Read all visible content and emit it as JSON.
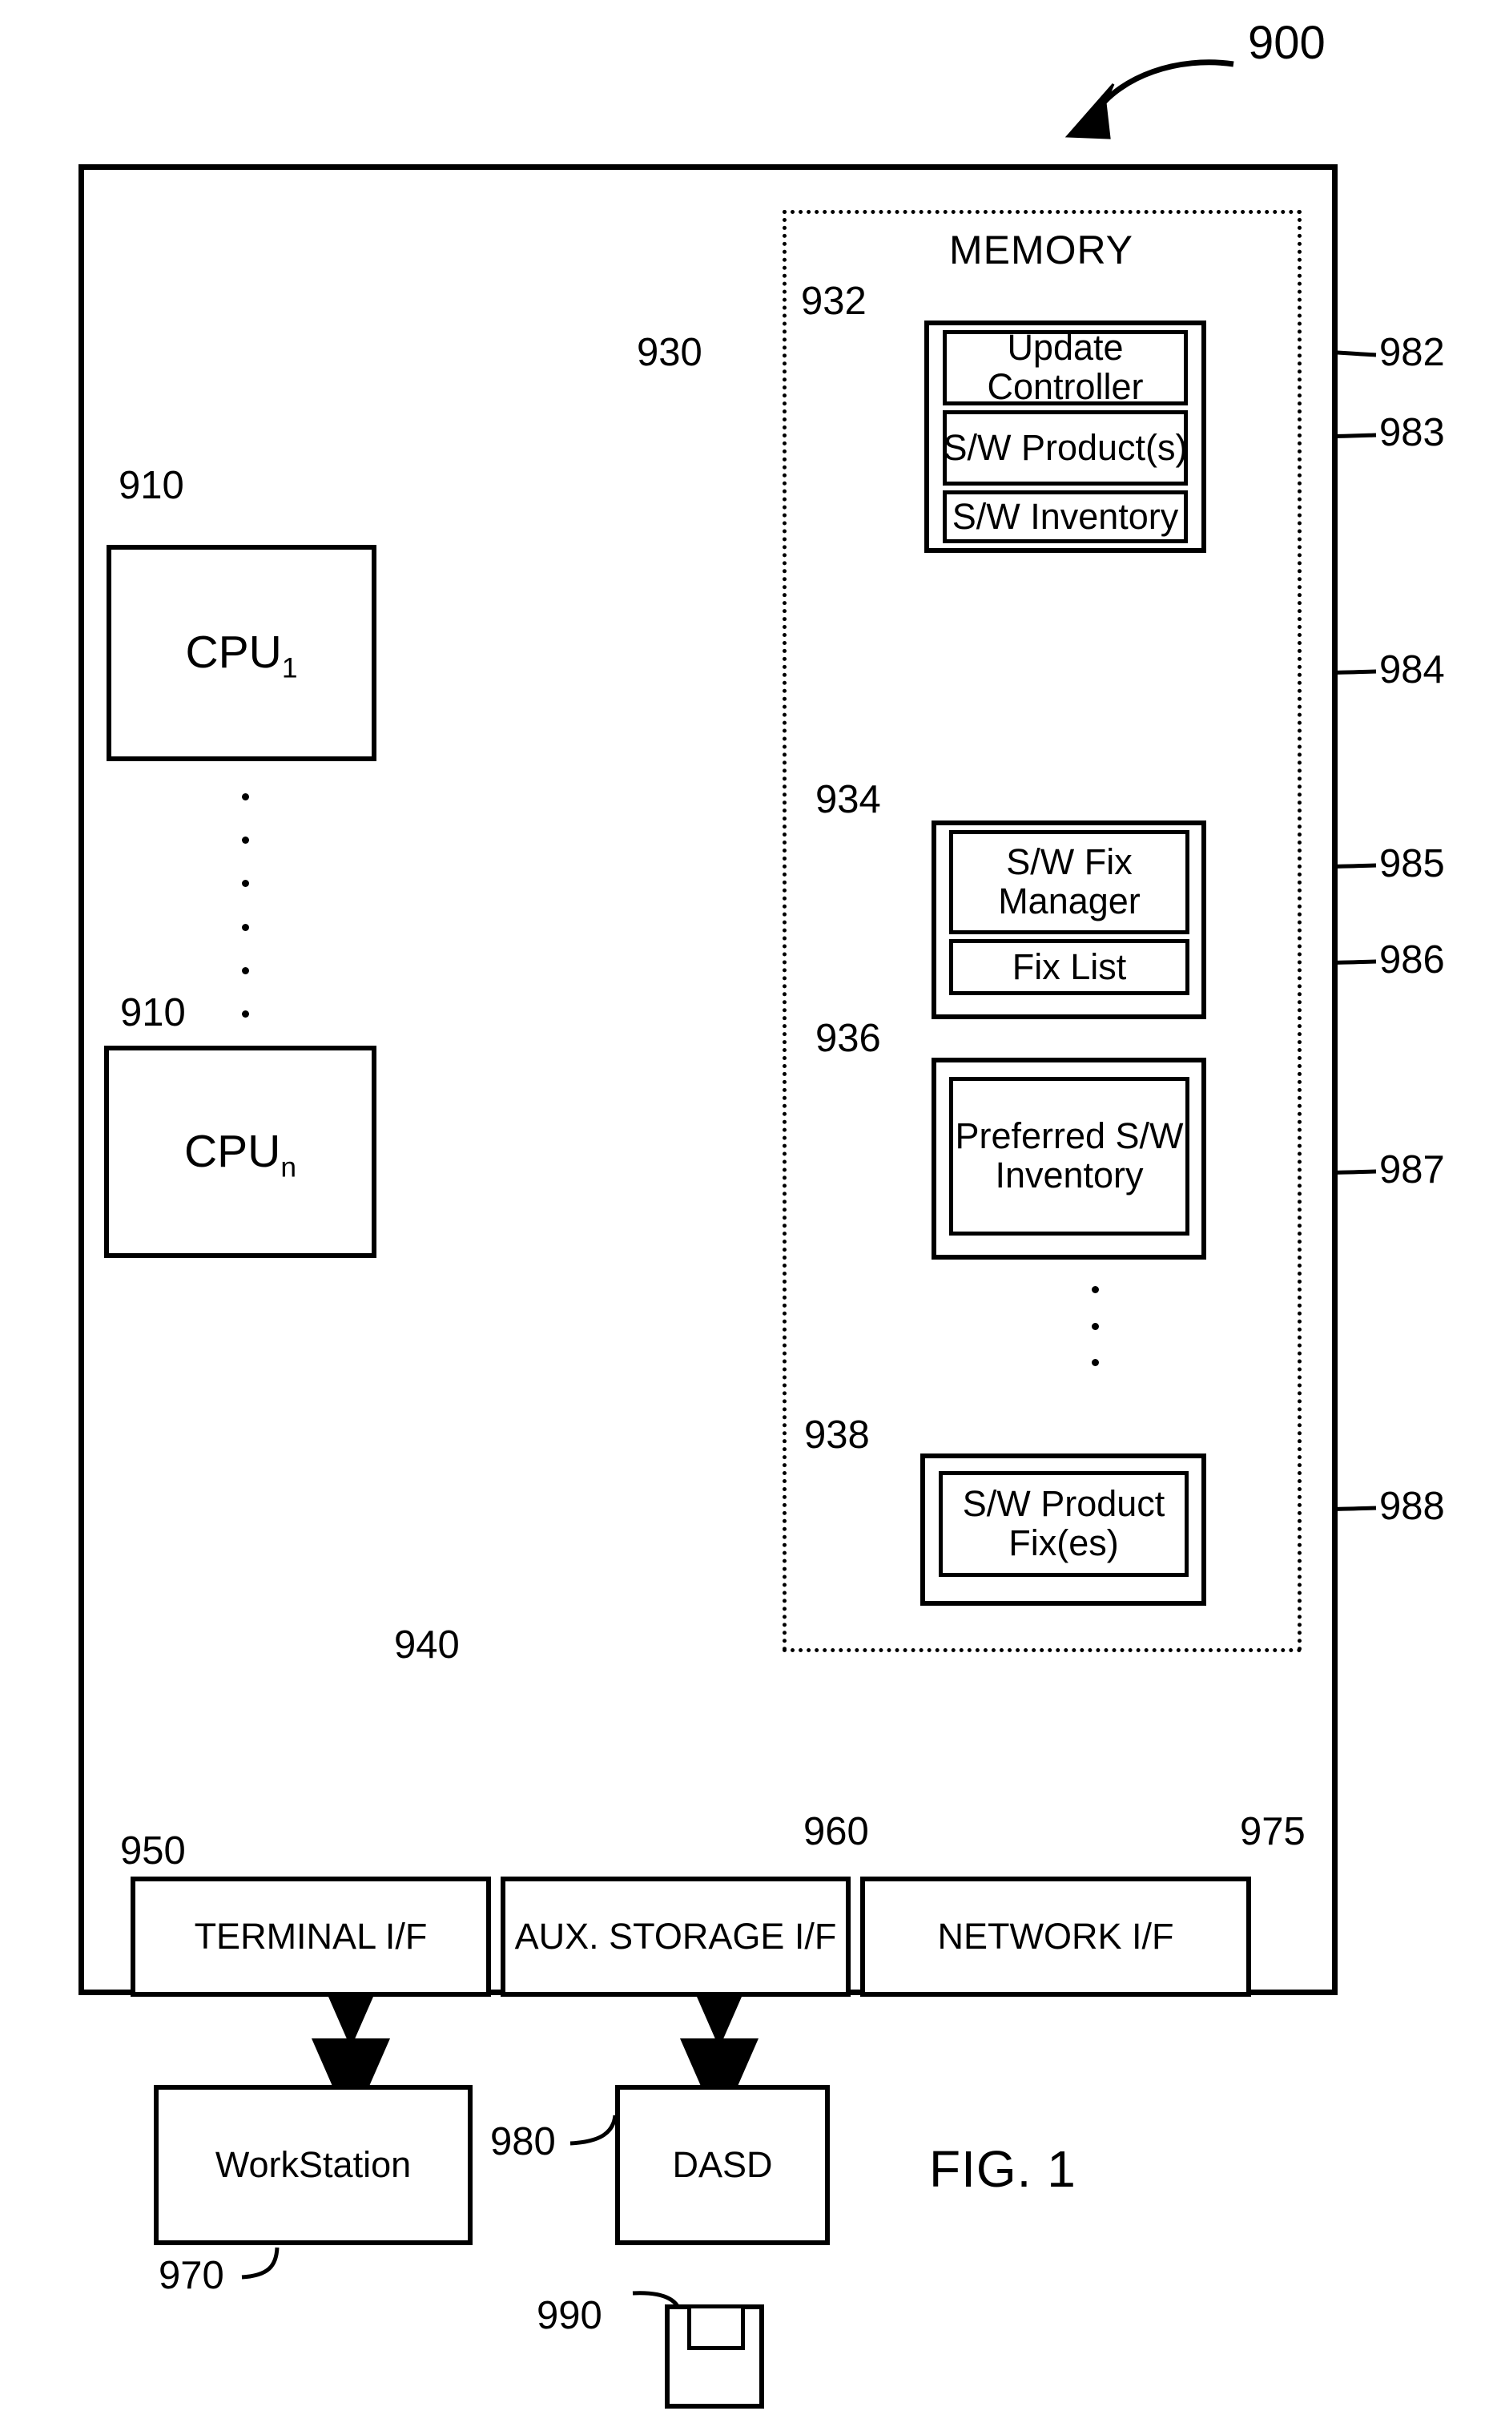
{
  "figure": {
    "label": "FIG. 1",
    "system_ref": "900"
  },
  "system": {
    "memory": {
      "title": "MEMORY",
      "ref": "930",
      "modules": [
        {
          "ref": "932",
          "cells": [
            {
              "text": "Update Controller",
              "ref": "982"
            },
            {
              "text": "S/W Product(s)",
              "ref": "983"
            },
            {
              "text": "S/W Inventory",
              "ref": "984"
            }
          ]
        },
        {
          "ref": "934",
          "cells": [
            {
              "text": "S/W Fix Manager",
              "ref": "985"
            },
            {
              "text": "Fix List",
              "ref": "986"
            }
          ]
        },
        {
          "ref": "936",
          "cells": [
            {
              "text": "Preferred S/W Inventory",
              "ref": "987"
            }
          ]
        },
        {
          "ref": "938",
          "cells": [
            {
              "text": "S/W Product Fix(es)",
              "ref": "988"
            }
          ]
        }
      ]
    },
    "processors": [
      {
        "name": "CPU",
        "subscript": "1",
        "ref": "910"
      },
      {
        "name": "CPU",
        "subscript": "n",
        "ref": "910"
      }
    ],
    "bus": {
      "ref": "940"
    },
    "interfaces": [
      {
        "label": "TERMINAL I/F",
        "ref": "950"
      },
      {
        "label": "AUX. STORAGE I/F",
        "ref": "960"
      },
      {
        "label": "NETWORK I/F",
        "ref": "975"
      }
    ]
  },
  "peripherals": [
    {
      "label": "WorkStation",
      "ref": "970",
      "icon": "none"
    },
    {
      "label": "DASD",
      "ref": "980",
      "icon": "none"
    },
    {
      "label": "",
      "ref": "990",
      "icon": "floppy-disk-icon"
    }
  ]
}
